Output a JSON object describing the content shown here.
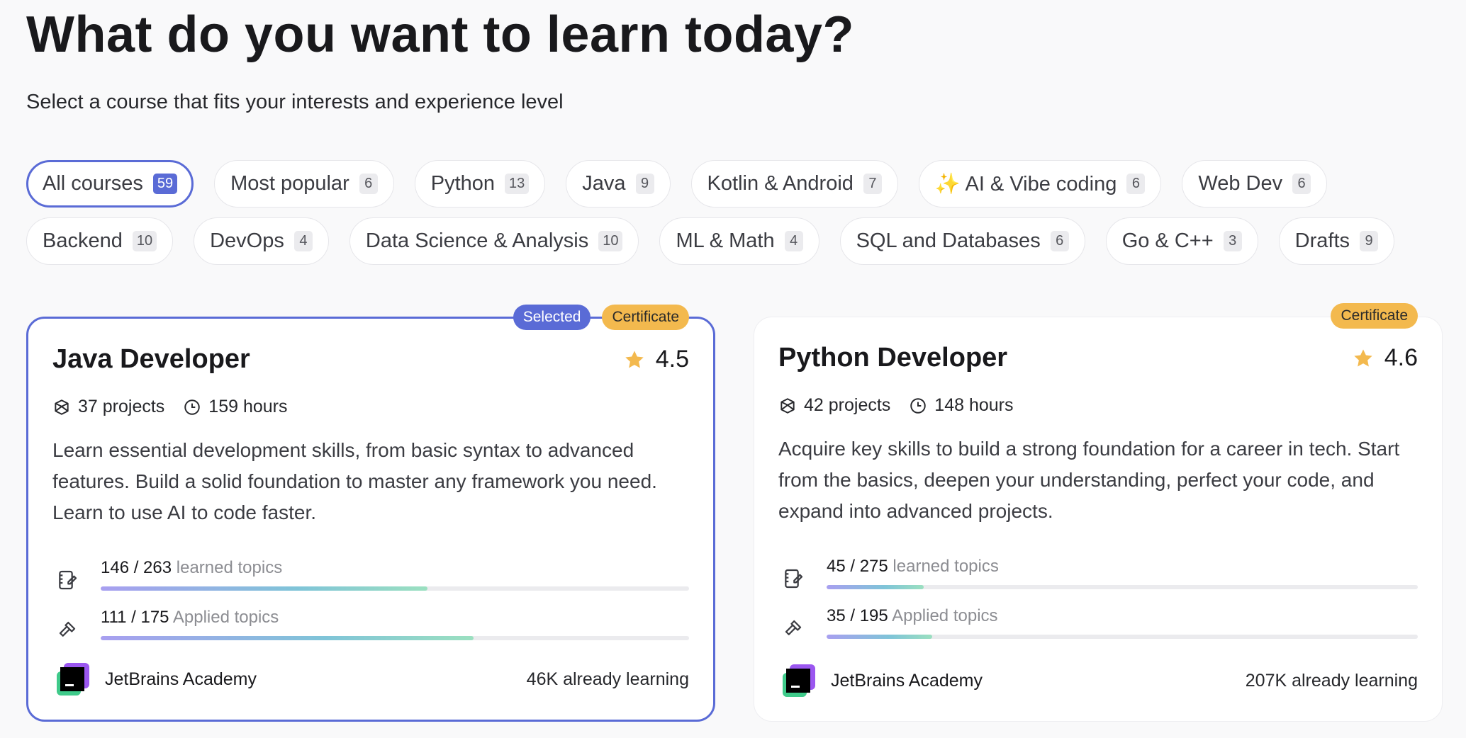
{
  "header": {
    "title": "What do you want to learn today?",
    "subtitle": "Select a course that fits your interests and experience level"
  },
  "filters": [
    {
      "label": "All courses",
      "count": "59"
    },
    {
      "label": "Most popular",
      "count": "6"
    },
    {
      "label": "Python",
      "count": "13"
    },
    {
      "label": "Java",
      "count": "9"
    },
    {
      "label": "Kotlin & Android",
      "count": "7"
    },
    {
      "label": "✨ AI & Vibe coding",
      "count": "6"
    },
    {
      "label": "Web Dev",
      "count": "6"
    },
    {
      "label": "Backend",
      "count": "10"
    },
    {
      "label": "DevOps",
      "count": "4"
    },
    {
      "label": "Data Science & Analysis",
      "count": "10"
    },
    {
      "label": "ML & Math",
      "count": "4"
    },
    {
      "label": "SQL and Databases",
      "count": "6"
    },
    {
      "label": "Go & C++",
      "count": "3"
    },
    {
      "label": "Drafts",
      "count": "9"
    }
  ],
  "colors": {
    "accent": "#5a6bd6",
    "certificate": "#f3b94e",
    "star": "#f3b94e"
  },
  "cards": [
    {
      "selected_badge": "Selected",
      "certificate_badge": "Certificate",
      "title": "Java Developer",
      "rating": "4.5",
      "projects": "37 projects",
      "hours": "159 hours",
      "description": "Learn essential development skills, from basic syntax to advanced features. Build a solid foundation to master any framework you need. Learn to use AI to code faster.",
      "learned": {
        "value": "146 / 263",
        "label": "learned topics",
        "progress": 0.555
      },
      "applied": {
        "value": "111 / 175",
        "label": "Applied topics",
        "progress": 0.634
      },
      "provider": "JetBrains Academy",
      "learners": "46K already learning"
    },
    {
      "certificate_badge": "Certificate",
      "title": "Python Developer",
      "rating": "4.6",
      "projects": "42 projects",
      "hours": "148 hours",
      "description": "Acquire key skills to build a strong foundation for a career in tech. Start from the basics, deepen your understanding, perfect your code, and expand into advanced projects.",
      "learned": {
        "value": "45 / 275",
        "label": "learned topics",
        "progress": 0.164
      },
      "applied": {
        "value": "35 / 195",
        "label": "Applied topics",
        "progress": 0.179
      },
      "provider": "JetBrains Academy",
      "learners": "207K already learning"
    }
  ]
}
